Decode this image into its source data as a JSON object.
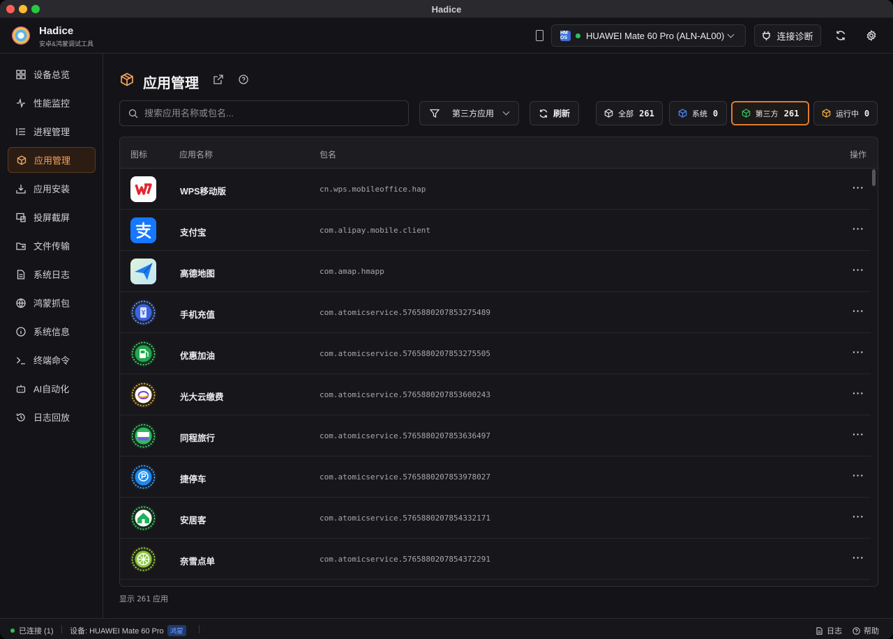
{
  "window": {
    "title": "Hadice"
  },
  "app": {
    "name": "Hadice",
    "subtitle": "安卓&鸿蒙调试工具"
  },
  "header": {
    "device_badge": "HM OS",
    "device_label": "HUAWEI Mate 60 Pro (ALN-AL00)",
    "diagnose_label": "连接诊断"
  },
  "sidebar": {
    "items": [
      {
        "label": "设备总览",
        "icon": "dashboard-icon"
      },
      {
        "label": "性能监控",
        "icon": "activity-icon"
      },
      {
        "label": "进程管理",
        "icon": "list-icon"
      },
      {
        "label": "应用管理",
        "icon": "package-icon",
        "active": true
      },
      {
        "label": "应用安装",
        "icon": "download-icon"
      },
      {
        "label": "投屏截屏",
        "icon": "screen-cast-icon"
      },
      {
        "label": "文件传输",
        "icon": "folder-icon"
      },
      {
        "label": "系统日志",
        "icon": "file-text-icon"
      },
      {
        "label": "鸿蒙抓包",
        "icon": "globe-icon"
      },
      {
        "label": "系统信息",
        "icon": "info-icon"
      },
      {
        "label": "终端命令",
        "icon": "terminal-icon"
      },
      {
        "label": "AI自动化",
        "icon": "bot-icon"
      },
      {
        "label": "日志回放",
        "icon": "history-icon"
      }
    ]
  },
  "page": {
    "title": "应用管理"
  },
  "search": {
    "placeholder": "搜索应用名称或包名..."
  },
  "filter": {
    "selected": "第三方应用"
  },
  "refresh_label": "刷新",
  "chips": [
    {
      "label": "全部",
      "count": "261",
      "color": "#d9d9d9"
    },
    {
      "label": "系统",
      "count": "0",
      "color": "#4a86f0"
    },
    {
      "label": "第三方",
      "count": "261",
      "color": "#2bc25a",
      "selected": true
    },
    {
      "label": "运行中",
      "count": "0",
      "color": "#f0a83a"
    }
  ],
  "table": {
    "headers": {
      "icon": "图标",
      "name": "应用名称",
      "package": "包名",
      "actions": "操作"
    },
    "rows": [
      {
        "name": "WPS移动版",
        "package": "cn.wps.mobileoffice.hap",
        "icon": "wps-icon"
      },
      {
        "name": "支付宝",
        "package": "com.alipay.mobile.client",
        "icon": "alipay-icon"
      },
      {
        "name": "高德地图",
        "package": "com.amap.hmapp",
        "icon": "amap-icon"
      },
      {
        "name": "手机充值",
        "package": "com.atomicservice.5765880207853275489",
        "icon": "phone-recharge-icon"
      },
      {
        "name": "优惠加油",
        "package": "com.atomicservice.5765880207853275505",
        "icon": "fuel-icon"
      },
      {
        "name": "光大云缴费",
        "package": "com.atomicservice.5765880207853600243",
        "icon": "cloud-pay-icon"
      },
      {
        "name": "同程旅行",
        "package": "com.atomicservice.5765880207853636497",
        "icon": "travel-icon"
      },
      {
        "name": "捷停车",
        "package": "com.atomicservice.5765880207853978027",
        "icon": "parking-icon"
      },
      {
        "name": "安居客",
        "package": "com.atomicservice.5765880207854332171",
        "icon": "house-icon"
      },
      {
        "name": "奈雪点单",
        "package": "com.atomicservice.5765880207854372291",
        "icon": "tea-icon"
      }
    ],
    "more_glyph": "···"
  },
  "footer": {
    "prefix": "显示",
    "count": "261",
    "suffix": "应用"
  },
  "status": {
    "connected": "已连接 (1)",
    "device": "设备: HUAWEI Mate 60 Pro",
    "os_tag": "鸿蒙",
    "logs": "日志",
    "help": "帮助"
  },
  "colors": {
    "accent": "#f6a35c",
    "accent_border": "#e07a2f",
    "online": "#2bc25a"
  }
}
